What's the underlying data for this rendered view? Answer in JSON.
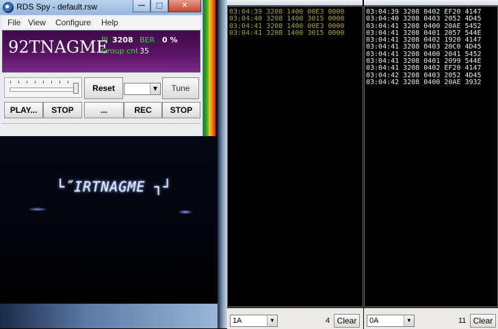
{
  "window": {
    "title": "RDS Spy - default.rsw",
    "min_symbol": "—",
    "max_symbol": "□",
    "close_symbol": "✕"
  },
  "menu": {
    "file": "File",
    "view": "View",
    "configure": "Configure",
    "help": "Help"
  },
  "display": {
    "ps_name": "92TNAGME",
    "pi_label": "PI",
    "pi_value": "3208",
    "ber_label": "BER",
    "ber_value": "0 %",
    "group_count_label": "Group cnt",
    "group_count_value": "35"
  },
  "controls": {
    "reset": "Reset",
    "tune": "Tune",
    "play": "PLAY...",
    "stop": "STOP",
    "browse": "...",
    "rec": "REC",
    "stop2": "STOP",
    "dropdown_arrow": "▼"
  },
  "video": {
    "lcd_text": "└˝IRTNAGME ┐┘"
  },
  "group_panels": [
    {
      "lines": [
        "03:04:39 3208 1400 00E3 0000",
        "03:04:40 3208 1400 3015 0000",
        "03:04:41 3208 1400 00E3 0000",
        "03:04:41 3208 1400 3015 0000"
      ],
      "group_type": "1A",
      "count": "4",
      "clear": "Clear"
    },
    {
      "lines": [
        "03:04:39 3208 0402 EF20 4147",
        "03:04:40 3208 0403 2052 4D45",
        "03:04:41 3208 0400 20AE 5452",
        "03:04:41 3208 0401 2057 544E",
        "03:04:41 3208 0402 1920 4147",
        "03:04:41 3208 0403 20C0 4D45",
        "03:04:41 3208 0400 2041 5452",
        "03:04:41 3208 0401 2099 544E",
        "03:04:41 3208 0402 EF20 4147",
        "03:04:42 3208 0403 2052 4D45",
        "03:04:42 3208 0400 20AE 3932"
      ],
      "group_type": "0A",
      "count": "11",
      "clear": "Clear"
    }
  ]
}
